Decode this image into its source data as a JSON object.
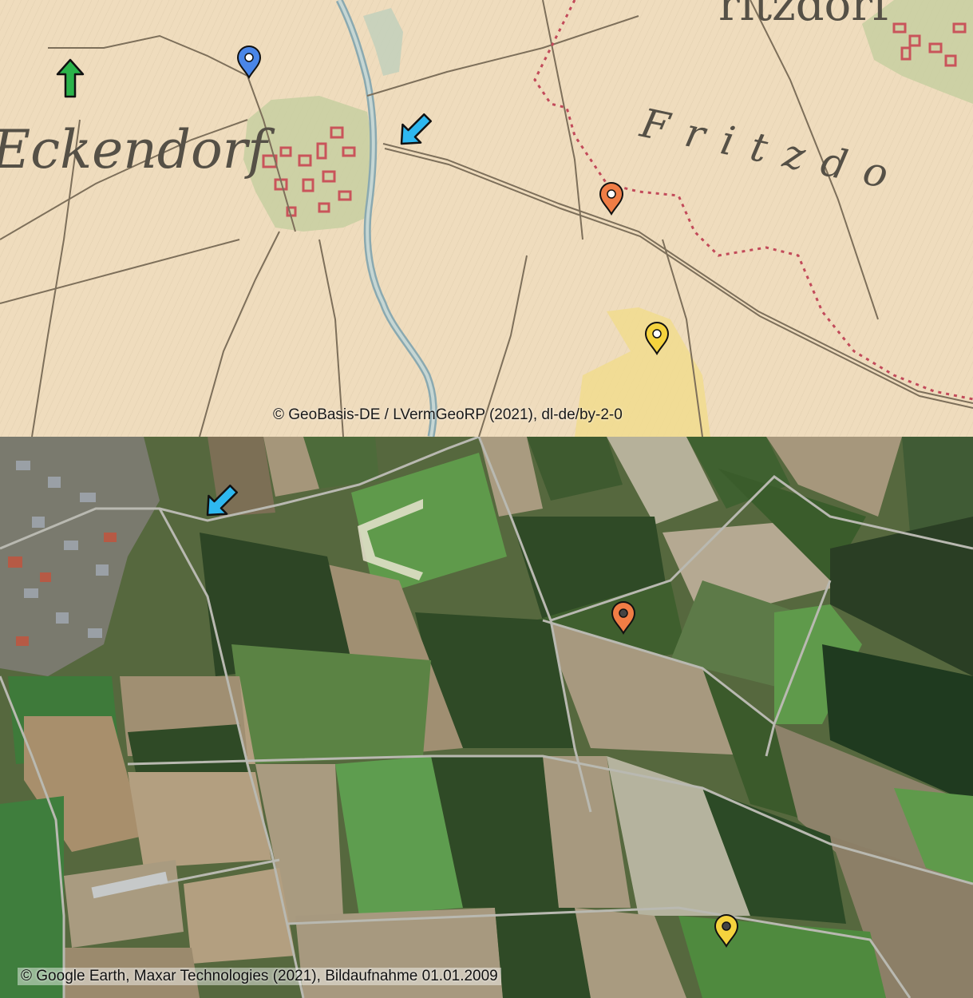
{
  "historic_map": {
    "place_labels": {
      "eckendorf": "Eckendorf",
      "fritzdorf_top": "ritzdorf",
      "fritzdorf_field": "Fritzdo"
    },
    "credit": "© GeoBasis-DE / LVermGeoRP (2021), dl-de/by-2-0",
    "markers": [
      {
        "name": "blue-pin",
        "color": "#4a86e8"
      },
      {
        "name": "orange-pin",
        "color": "#f07d45"
      },
      {
        "name": "yellow-pin",
        "color": "#f5d33e"
      }
    ],
    "arrows": [
      {
        "name": "north-arrow",
        "color": "#2bb34a"
      },
      {
        "name": "crossing-arrow",
        "color": "#2eb8f0"
      }
    ]
  },
  "satellite_map": {
    "credit": "© Google Earth, Maxar Technologies (2021), Bildaufnahme 01.01.2009",
    "markers": [
      {
        "name": "orange-pin",
        "color": "#f07d45"
      },
      {
        "name": "yellow-pin",
        "color": "#f5d33e"
      }
    ],
    "arrows": [
      {
        "name": "crossing-arrow",
        "color": "#2eb8f0"
      }
    ]
  }
}
